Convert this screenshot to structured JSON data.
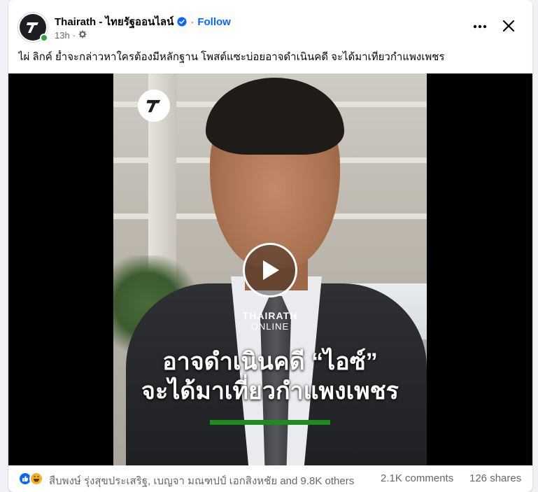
{
  "post": {
    "page_name": "Thairath - ไทยรัฐออนไลน์",
    "follow_label": "Follow",
    "separator": "·",
    "time": "13h",
    "meta_separator": "·",
    "text": "ไผ่ ลิกค์ ย้ำจะกล่าวหาใครต้องมีหลักฐาน โพสต์แซะบ่อยอาจดำเนินคดี จะได้มาเที่ยวกำแพงเพชร"
  },
  "video": {
    "watermark_line1": "THAIRATH",
    "watermark_line2": "ONLINE",
    "caption_line1": "อาจดำเนินคดี “ไอซ์”",
    "caption_line2": "จะได้มาเที่ยวกำแพงเพชร"
  },
  "footer": {
    "reactors": "สืบพงษ์ รุ่งสุขประเสริฐ, เบญจา มณฑปป์ เอกสิงหชัย and 9.8K others",
    "comments": "2.1K comments",
    "shares": "126 shares"
  },
  "icons": {
    "avatar": "thairath-logo-icon",
    "verified": "verified-badge-icon",
    "privacy": "globe-gear-icon",
    "more": "more-options-icon",
    "close": "close-icon",
    "play": "play-icon",
    "like": "like-reaction-icon",
    "haha": "haha-reaction-icon"
  },
  "colors": {
    "accent": "#0866ff",
    "online": "#31a24c",
    "verified": "#0866ff",
    "caption_bar": "#1c8c1c"
  }
}
